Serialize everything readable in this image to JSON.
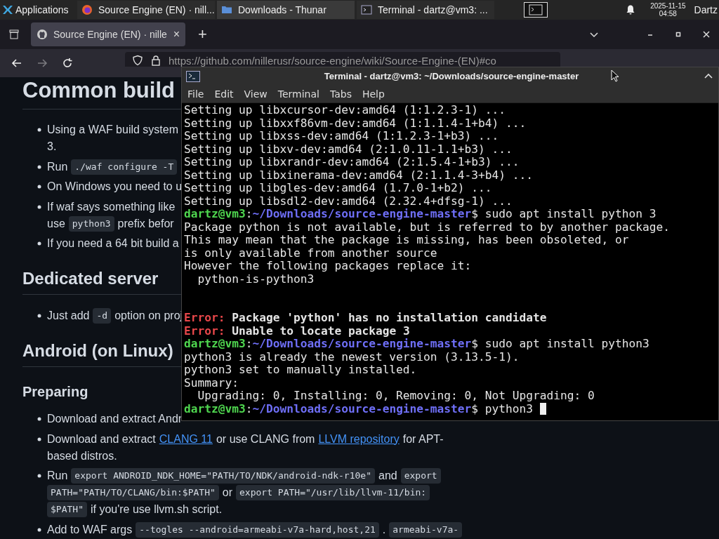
{
  "taskbar": {
    "apps_menu": "Applications",
    "tasks": [
      {
        "label": "Source Engine (EN) · nill..."
      },
      {
        "label": "Downloads - Thunar"
      },
      {
        "label": "Terminal - dartz@vm3: ..."
      }
    ],
    "date": "2025-11-15",
    "time": "04:58",
    "user": "Dartz"
  },
  "browser": {
    "tab": {
      "title": "Source Engine (EN) · nille",
      "close": "×"
    },
    "new_tab": "+",
    "url": "https://github.com/nillerusr/source-engine/wiki/Source-Engine-(EN)#co",
    "forward_disabled": true
  },
  "page": [
    {
      "kind": "h1",
      "text": "Common build"
    },
    {
      "kind": "list",
      "items": [
        {
          "lines": [
            [
              {
                "kind": "text",
                "text": "Using a WAF build system"
              }
            ],
            [
              {
                "kind": "text",
                "text": "3."
              }
            ]
          ]
        },
        {
          "lines": [
            [
              {
                "kind": "text",
                "text": "Run"
              },
              {
                "kind": "code",
                "text": "./waf configure -T"
              }
            ]
          ]
        },
        {
          "lines": [
            [
              {
                "kind": "text",
                "text": "On Windows you need to u"
              }
            ]
          ]
        },
        {
          "lines": [
            [
              {
                "kind": "text",
                "text": "If waf says something like"
              }
            ],
            [
              {
                "kind": "text",
                "text": "use"
              },
              {
                "kind": "code",
                "text": "python3"
              },
              {
                "kind": "text",
                "text": "prefix befor"
              }
            ]
          ]
        },
        {
          "lines": [
            [
              {
                "kind": "text",
                "text": "If you need a 64 bit build a"
              }
            ]
          ]
        }
      ]
    },
    {
      "kind": "h2",
      "text": "Dedicated server"
    },
    {
      "kind": "list",
      "items": [
        {
          "lines": [
            [
              {
                "kind": "text",
                "text": "Just add"
              },
              {
                "kind": "code",
                "text": "-d"
              },
              {
                "kind": "text",
                "text": "option on proj"
              }
            ]
          ]
        }
      ]
    },
    {
      "kind": "h2",
      "text": "Android (on Linux)"
    },
    {
      "kind": "h3",
      "text": "Preparing"
    },
    {
      "kind": "list",
      "items": [
        {
          "lines": [
            [
              {
                "kind": "text",
                "text": "Download and extract Andr"
              }
            ]
          ]
        },
        {
          "lines": [
            [
              {
                "kind": "text",
                "text": "Download and extract"
              },
              {
                "kind": "link",
                "text": "CLANG 11"
              },
              {
                "kind": "text",
                "text": "or use CLANG from"
              },
              {
                "kind": "link",
                "text": "LLVM repository"
              },
              {
                "kind": "text",
                "text": "for APT-"
              }
            ],
            [
              {
                "kind": "text",
                "text": "based distros."
              }
            ]
          ]
        },
        {
          "lines": [
            [
              {
                "kind": "text",
                "text": "Run"
              },
              {
                "kind": "code",
                "text": "export ANDROID_NDK_HOME=\"PATH/TO/NDK/android-ndk-r10e\""
              },
              {
                "kind": "text",
                "text": "and"
              },
              {
                "kind": "code",
                "text": "export"
              }
            ],
            [
              {
                "kind": "code",
                "text": "PATH=\"PATH/TO/CLANG/bin:$PATH\""
              },
              {
                "kind": "text",
                "text": "or"
              },
              {
                "kind": "code",
                "text": "export PATH=\"/usr/lib/llvm-11/bin:"
              }
            ],
            [
              {
                "kind": "code",
                "text": "$PATH\""
              },
              {
                "kind": "text",
                "text": "if you're use llvm.sh script."
              }
            ]
          ]
        },
        {
          "lines": [
            [
              {
                "kind": "text",
                "text": "Add to WAF args"
              },
              {
                "kind": "code",
                "text": "--togles --android=armeabi-v7a-hard,host,21"
              },
              {
                "kind": "text",
                "text": "."
              },
              {
                "kind": "code",
                "text": "armeabi-v7a-"
              }
            ]
          ]
        }
      ]
    }
  ],
  "terminal": {
    "title": "Terminal - dartz@vm3: ~/Downloads/source-engine-master",
    "menu": [
      "File",
      "Edit",
      "View",
      "Terminal",
      "Tabs",
      "Help"
    ],
    "lines": [
      {
        "kind": "output",
        "text": "Setting up libxcursor-dev:amd64 (1:1.2.3-1) ..."
      },
      {
        "kind": "output",
        "text": "Setting up libxxf86vm-dev:amd64 (1:1.1.4-1+b4) ..."
      },
      {
        "kind": "output",
        "text": "Setting up libxss-dev:amd64 (1:1.2.3-1+b3) ..."
      },
      {
        "kind": "output",
        "text": "Setting up libxv-dev:amd64 (2:1.0.11-1.1+b3) ..."
      },
      {
        "kind": "output",
        "text": "Setting up libxrandr-dev:amd64 (2:1.5.4-1+b3) ..."
      },
      {
        "kind": "output",
        "text": "Setting up libxinerama-dev:amd64 (2:1.1.4-3+b4) ..."
      },
      {
        "kind": "output",
        "text": "Setting up libgles-dev:amd64 (1.7.0-1+b2) ..."
      },
      {
        "kind": "output",
        "text": "Setting up libsdl2-dev:amd64 (2.32.4+dfsg-1) ..."
      },
      {
        "kind": "prompt",
        "user": "dartz@vm3",
        "colon": ":",
        "path": "~/Downloads/source-engine-master",
        "sign": "$",
        "command": "sudo apt install python 3",
        "cursor": false
      },
      {
        "kind": "output",
        "text": "Package python is not available, but is referred to by another package."
      },
      {
        "kind": "output",
        "text": "This may mean that the package is missing, has been obsoleted, or"
      },
      {
        "kind": "output",
        "text": "is only available from another source"
      },
      {
        "kind": "output",
        "text": "However the following packages replace it:"
      },
      {
        "kind": "output",
        "text": "  python-is-python3"
      },
      {
        "kind": "blank"
      },
      {
        "kind": "blank"
      },
      {
        "kind": "error",
        "label": "Error:",
        "text": "Package 'python' has no installation candidate"
      },
      {
        "kind": "error",
        "label": "Error:",
        "text": "Unable to locate package 3"
      },
      {
        "kind": "prompt",
        "user": "dartz@vm3",
        "colon": ":",
        "path": "~/Downloads/source-engine-master",
        "sign": "$",
        "command": "sudo apt install python3",
        "cursor": false
      },
      {
        "kind": "output",
        "text": "python3 is already the newest version (3.13.5-1)."
      },
      {
        "kind": "output",
        "text": "python3 set to manually installed."
      },
      {
        "kind": "output",
        "text": "Summary:"
      },
      {
        "kind": "output",
        "text": "  Upgrading: 0, Installing: 0, Removing: 0, Not Upgrading: 0"
      },
      {
        "kind": "prompt",
        "user": "dartz@vm3",
        "colon": ":",
        "path": "~/Downloads/source-engine-master",
        "sign": "$",
        "command": "python3",
        "cursor": true
      }
    ]
  }
}
